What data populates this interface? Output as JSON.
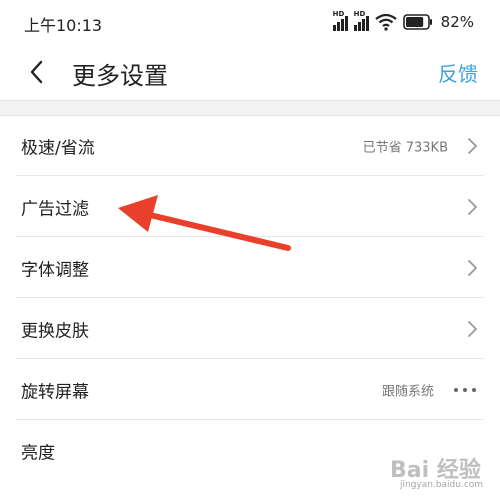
{
  "status_bar": {
    "time": "上午10:13",
    "signal_tag": "HD",
    "battery_percent": "82%"
  },
  "nav": {
    "title": "更多设置",
    "feedback_label": "反馈"
  },
  "settings": {
    "items": [
      {
        "label": "极速/省流",
        "value": "已节省 733KB",
        "accessory": "chevron-right-icon"
      },
      {
        "label": "广告过滤",
        "value": "",
        "accessory": "chevron-right-icon"
      },
      {
        "label": "字体调整",
        "value": "",
        "accessory": "chevron-right-icon"
      },
      {
        "label": "更换皮肤",
        "value": "",
        "accessory": "chevron-right-icon"
      },
      {
        "label": "旋转屏幕",
        "value": "跟随系统",
        "accessory": "more-dots-icon"
      },
      {
        "label": "亮度",
        "value": "",
        "accessory": ""
      }
    ]
  },
  "annotation": {
    "arrow_color": "#e8402a"
  },
  "watermark": {
    "brand": "Bai 经验",
    "url": "jingyan.baidu.com"
  }
}
